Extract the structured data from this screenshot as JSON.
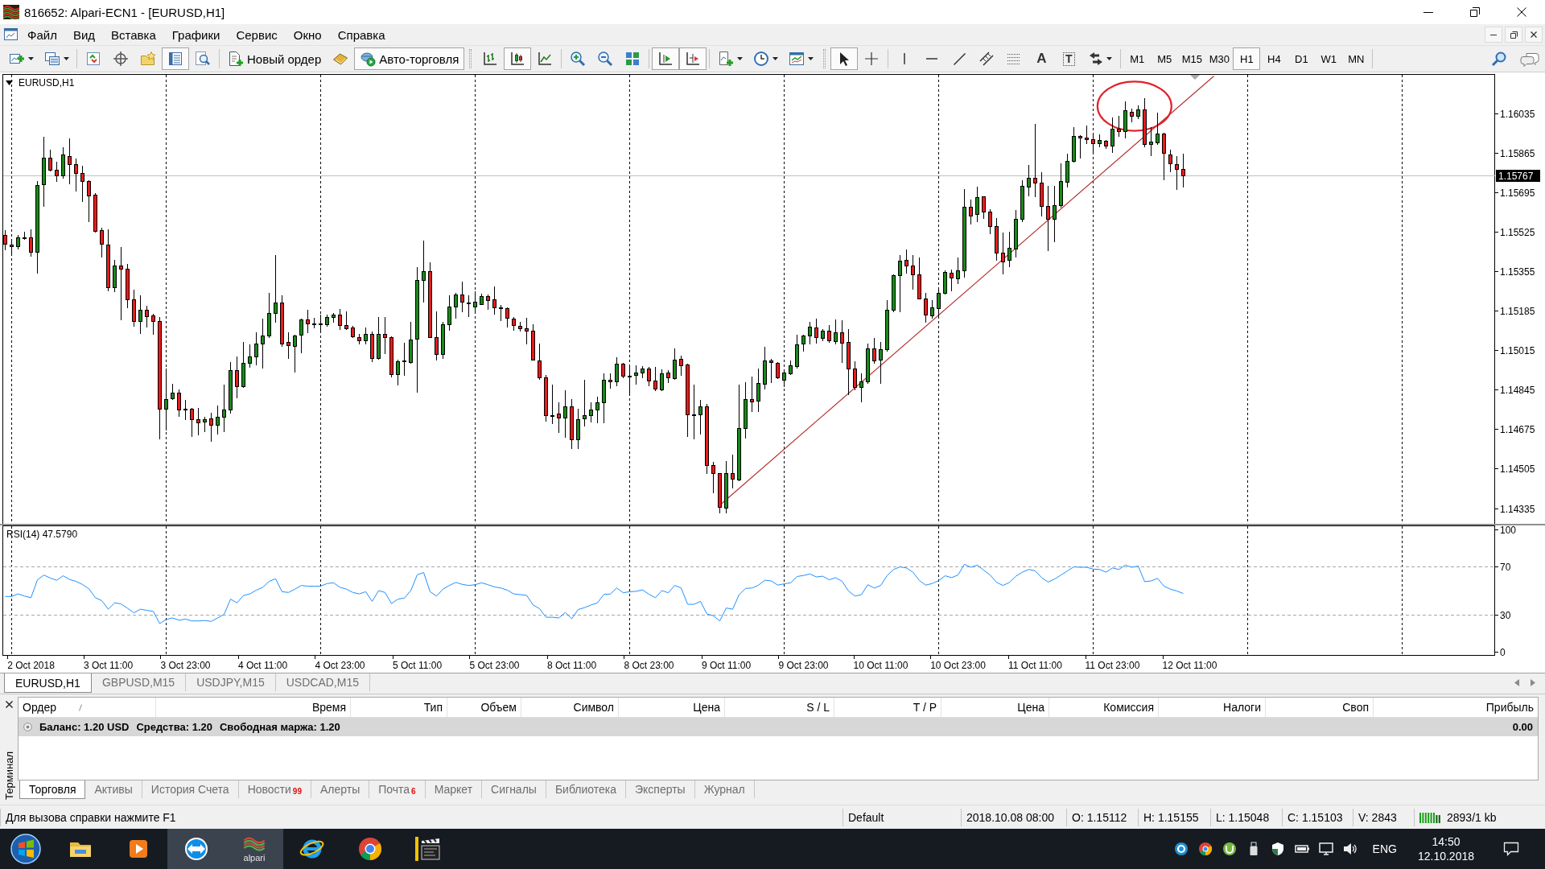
{
  "window": {
    "title": "816652: Alpari-ECN1 - [EURUSD,H1]"
  },
  "menu": [
    "Файл",
    "Вид",
    "Вставка",
    "Графики",
    "Сервис",
    "Окно",
    "Справка"
  ],
  "toolbar": {
    "items": [
      {
        "kind": "icon",
        "pressed": false
      },
      {
        "kind": "icon",
        "pressed": false
      },
      {
        "kind": "icon",
        "pressed": false
      },
      {
        "kind": "icon",
        "pressed": false
      },
      {
        "kind": "icon",
        "pressed": false
      },
      {
        "kind": "icon",
        "pressed": true
      },
      {
        "kind": "icon",
        "pressed": false
      },
      {
        "kind": "button",
        "label": "Новый ордер",
        "pressed": false
      },
      {
        "kind": "icon",
        "pressed": false
      },
      {
        "kind": "button",
        "label": "Авто-торговля",
        "pressed": true
      },
      {
        "kind": "icon",
        "pressed": false
      },
      {
        "kind": "icon",
        "pressed": true
      },
      {
        "kind": "icon",
        "pressed": false
      },
      {
        "kind": "icon",
        "pressed": false
      },
      {
        "kind": "icon",
        "pressed": false
      },
      {
        "kind": "icon",
        "pressed": false
      },
      {
        "kind": "icon",
        "pressed": true
      },
      {
        "kind": "icon",
        "pressed": true
      },
      {
        "kind": "icon",
        "pressed": false
      },
      {
        "kind": "icon",
        "pressed": false
      },
      {
        "kind": "icon",
        "pressed": false
      },
      {
        "kind": "icon",
        "pressed": true
      },
      {
        "kind": "icon",
        "pressed": false
      },
      {
        "kind": "icon",
        "pressed": false
      },
      {
        "kind": "icon",
        "pressed": false
      },
      {
        "kind": "icon",
        "pressed": false
      },
      {
        "kind": "icon",
        "pressed": false
      },
      {
        "kind": "icon",
        "pressed": false
      },
      {
        "kind": "glyph",
        "glyph": "A",
        "pressed": false
      },
      {
        "kind": "boxed_glyph",
        "glyph": "T",
        "pressed": false
      },
      {
        "kind": "icon",
        "pressed": false
      }
    ],
    "timeframes": [
      {
        "label": "M1",
        "selected": false
      },
      {
        "label": "M5",
        "selected": false
      },
      {
        "label": "M15",
        "selected": false
      },
      {
        "label": "M30",
        "selected": false
      },
      {
        "label": "H1",
        "selected": true
      },
      {
        "label": "H4",
        "selected": false
      },
      {
        "label": "D1",
        "selected": false
      },
      {
        "label": "W1",
        "selected": false
      },
      {
        "label": "MN",
        "selected": false
      }
    ]
  },
  "chart": {
    "chart_data": [
      {
        "type": "candlestick",
        "title": "EURUSD,H1",
        "ylim": [
          1.14271,
          1.16201
        ],
        "yticks": [
          1.14335,
          1.14505,
          1.14675,
          1.14845,
          1.15015,
          1.15185,
          1.15355,
          1.15525,
          1.15695,
          1.15865,
          1.16035
        ],
        "grid": true,
        "ref_lines": [
          {
            "axis": "y",
            "value": 1.15767,
            "label": "1.15767",
            "color": "#c0c0c0"
          }
        ],
        "ohlc": [
          [
            1.1551,
            1.15532,
            1.15448,
            1.15473
          ],
          [
            1.15471,
            1.15492,
            1.15426,
            1.15463
          ],
          [
            1.15462,
            1.1551,
            1.15452,
            1.15502
          ],
          [
            1.15497,
            1.15525,
            1.15494,
            1.15502
          ],
          [
            1.155,
            1.15535,
            1.15421,
            1.1544
          ],
          [
            1.15438,
            1.15742,
            1.15349,
            1.15727
          ],
          [
            1.15731,
            1.15933,
            1.15637,
            1.15845
          ],
          [
            1.15845,
            1.15879,
            1.15787,
            1.15792
          ],
          [
            1.15793,
            1.15827,
            1.15744,
            1.15768
          ],
          [
            1.15768,
            1.15889,
            1.15756,
            1.15859
          ],
          [
            1.15851,
            1.15926,
            1.15734,
            1.15817
          ],
          [
            1.15817,
            1.15841,
            1.15703,
            1.15777
          ],
          [
            1.1578,
            1.15808,
            1.15657,
            1.15744
          ],
          [
            1.15745,
            1.15746,
            1.15572,
            1.15681
          ],
          [
            1.15683,
            1.1569,
            1.15525,
            1.15528
          ],
          [
            1.15533,
            1.15541,
            1.15417,
            1.15473
          ],
          [
            1.15471,
            1.15535,
            1.15272,
            1.15286
          ],
          [
            1.15286,
            1.15403,
            1.15269,
            1.15381
          ],
          [
            1.1538,
            1.15461,
            1.15147,
            1.15365
          ],
          [
            1.15367,
            1.15386,
            1.15198,
            1.15234
          ],
          [
            1.15234,
            1.15275,
            1.15119,
            1.15141
          ],
          [
            1.15141,
            1.1525,
            1.15088,
            1.15188
          ],
          [
            1.15188,
            1.15207,
            1.15116,
            1.15162
          ],
          [
            1.15166,
            1.15172,
            1.15085,
            1.15141
          ],
          [
            1.15141,
            1.15157,
            1.14636,
            1.14763
          ],
          [
            1.14763,
            1.14936,
            1.14673,
            1.14804
          ],
          [
            1.14807,
            1.14872,
            1.14804,
            1.14832
          ],
          [
            1.14832,
            1.14845,
            1.14732,
            1.1476
          ],
          [
            1.14762,
            1.148,
            1.14717,
            1.14763
          ],
          [
            1.14763,
            1.14766,
            1.14645,
            1.14717
          ],
          [
            1.14717,
            1.14766,
            1.14652,
            1.14703
          ],
          [
            1.14707,
            1.14729,
            1.14667,
            1.14717
          ],
          [
            1.14721,
            1.14744,
            1.14626,
            1.14693
          ],
          [
            1.14693,
            1.14776,
            1.14655,
            1.1473
          ],
          [
            1.1473,
            1.14868,
            1.14665,
            1.1476
          ],
          [
            1.14758,
            1.14965,
            1.14745,
            1.14929
          ],
          [
            1.14929,
            1.14988,
            1.1481,
            1.14859
          ],
          [
            1.14859,
            1.15052,
            1.14858,
            1.14959
          ],
          [
            1.14959,
            1.15039,
            1.14944,
            1.14987
          ],
          [
            1.14987,
            1.15093,
            1.14952,
            1.15042
          ],
          [
            1.15042,
            1.15151,
            1.1494,
            1.15079
          ],
          [
            1.15079,
            1.15262,
            1.1507,
            1.15176
          ],
          [
            1.15176,
            1.15424,
            1.15138,
            1.1522
          ],
          [
            1.1522,
            1.1525,
            1.15035,
            1.15045
          ],
          [
            1.1505,
            1.15091,
            1.14983,
            1.15037
          ],
          [
            1.15033,
            1.15083,
            1.14921,
            1.15079
          ],
          [
            1.15081,
            1.15151,
            1.15006,
            1.15146
          ],
          [
            1.15146,
            1.15188,
            1.15091,
            1.1513
          ],
          [
            1.15132,
            1.15155,
            1.15114,
            1.15131
          ],
          [
            1.1513,
            1.15169,
            1.15099,
            1.15129
          ],
          [
            1.15128,
            1.15167,
            1.1512,
            1.15157
          ],
          [
            1.15157,
            1.15174,
            1.15136,
            1.15168
          ],
          [
            1.15168,
            1.15194,
            1.15107,
            1.15122
          ],
          [
            1.15123,
            1.15182,
            1.15107,
            1.15111
          ],
          [
            1.15112,
            1.1512,
            1.1507,
            1.15074
          ],
          [
            1.15073,
            1.15085,
            1.15045,
            1.15057
          ],
          [
            1.15057,
            1.15114,
            1.15045,
            1.15086
          ],
          [
            1.15086,
            1.15095,
            1.14967,
            1.1498
          ],
          [
            1.1498,
            1.15157,
            1.14977,
            1.15086
          ],
          [
            1.15086,
            1.15157,
            1.15002,
            1.15073
          ],
          [
            1.1507,
            1.15076,
            1.14903,
            1.14913
          ],
          [
            1.14913,
            1.14974,
            1.14866,
            1.14969
          ],
          [
            1.1497,
            1.15048,
            1.14909,
            1.14971
          ],
          [
            1.14965,
            1.15137,
            1.14959,
            1.1506
          ],
          [
            1.15064,
            1.15374,
            1.14835,
            1.15318
          ],
          [
            1.15318,
            1.15488,
            1.15223,
            1.15355
          ],
          [
            1.15355,
            1.15393,
            1.15072,
            1.15073
          ],
          [
            1.15073,
            1.15184,
            1.14974,
            1.14998
          ],
          [
            1.14998,
            1.15138,
            1.14983,
            1.15128
          ],
          [
            1.15128,
            1.1525,
            1.15104,
            1.15203
          ],
          [
            1.15203,
            1.15262,
            1.15153,
            1.15256
          ],
          [
            1.15256,
            1.15312,
            1.15182,
            1.15225
          ],
          [
            1.15219,
            1.1525,
            1.15163,
            1.15218
          ],
          [
            1.15204,
            1.15269,
            1.15176,
            1.15223
          ],
          [
            1.15215,
            1.15259,
            1.15213,
            1.15249
          ],
          [
            1.15249,
            1.15256,
            1.15192,
            1.15231
          ],
          [
            1.15234,
            1.15291,
            1.15172,
            1.152
          ],
          [
            1.15198,
            1.15209,
            1.15145,
            1.15197
          ],
          [
            1.15197,
            1.152,
            1.15116,
            1.15153
          ],
          [
            1.15151,
            1.15157,
            1.15101,
            1.15122
          ],
          [
            1.1512,
            1.15138,
            1.15099,
            1.1511
          ],
          [
            1.15111,
            1.15153,
            1.15045,
            1.151
          ],
          [
            1.15099,
            1.15126,
            1.14974,
            1.14975
          ],
          [
            1.14971,
            1.15045,
            1.1489,
            1.14897
          ],
          [
            1.14897,
            1.14909,
            1.14711,
            1.14735
          ],
          [
            1.14736,
            1.14866,
            1.14702,
            1.14735
          ],
          [
            1.14742,
            1.14791,
            1.14661,
            1.14726
          ],
          [
            1.14726,
            1.14841,
            1.14642,
            1.14773
          ],
          [
            1.14773,
            1.14806,
            1.14593,
            1.1463
          ],
          [
            1.1463,
            1.14763,
            1.14593,
            1.14717
          ],
          [
            1.14723,
            1.14888,
            1.1469,
            1.14735
          ],
          [
            1.14735,
            1.14791,
            1.14707,
            1.1476
          ],
          [
            1.1476,
            1.14816,
            1.14703,
            1.14791
          ],
          [
            1.14791,
            1.14915,
            1.14703,
            1.14888
          ],
          [
            1.14888,
            1.14915,
            1.14852,
            1.14881
          ],
          [
            1.14881,
            1.14986,
            1.14863,
            1.14956
          ],
          [
            1.14956,
            1.14959,
            1.14897,
            1.14905
          ],
          [
            1.14906,
            1.14952,
            1.14822,
            1.14905
          ],
          [
            1.14909,
            1.14951,
            1.14872,
            1.14918
          ],
          [
            1.14918,
            1.14946,
            1.14897,
            1.14938
          ],
          [
            1.14936,
            1.14944,
            1.14863,
            1.14884
          ],
          [
            1.14884,
            1.14944,
            1.14841,
            1.1485
          ],
          [
            1.14847,
            1.14934,
            1.14841,
            1.14915
          ],
          [
            1.14919,
            1.14928,
            1.14878,
            1.14897
          ],
          [
            1.14894,
            1.15023,
            1.1489,
            1.14975
          ],
          [
            1.14977,
            1.1499,
            1.14909,
            1.14949
          ],
          [
            1.14954,
            1.14956,
            1.14646,
            1.1474
          ],
          [
            1.14738,
            1.14868,
            1.14634,
            1.14737
          ],
          [
            1.14738,
            1.14801,
            1.14657,
            1.14775
          ],
          [
            1.14773,
            1.14785,
            1.14485,
            1.14522
          ],
          [
            1.14522,
            1.14535,
            1.14401,
            1.14485
          ],
          [
            1.14485,
            1.14486,
            1.14316,
            1.14341
          ],
          [
            1.14336,
            1.14537,
            1.14316,
            1.14487
          ],
          [
            1.14487,
            1.14566,
            1.14422,
            1.1446
          ],
          [
            1.14459,
            1.14868,
            1.14456,
            1.1468
          ],
          [
            1.1468,
            1.14878,
            1.14639,
            1.14804
          ],
          [
            1.14804,
            1.14903,
            1.14754,
            1.14795
          ],
          [
            1.14797,
            1.14938,
            1.14754,
            1.14874
          ],
          [
            1.14872,
            1.15029,
            1.1485,
            1.14971
          ],
          [
            1.14971,
            1.14977,
            1.14877,
            1.14965
          ],
          [
            1.14962,
            1.14965,
            1.14896,
            1.14897
          ],
          [
            1.14887,
            1.14928,
            1.14859,
            1.14918
          ],
          [
            1.14915,
            1.14971,
            1.14912,
            1.14949
          ],
          [
            1.14946,
            1.15083,
            1.1494,
            1.1504
          ],
          [
            1.15043,
            1.15083,
            1.15011,
            1.15078
          ],
          [
            1.15078,
            1.15137,
            1.15045,
            1.15116
          ],
          [
            1.15114,
            1.15151,
            1.15048,
            1.1507
          ],
          [
            1.15068,
            1.15107,
            1.15058,
            1.15099
          ],
          [
            1.15099,
            1.15122,
            1.15049,
            1.15058
          ],
          [
            1.15055,
            1.15147,
            1.15045,
            1.15091
          ],
          [
            1.15091,
            1.15145,
            1.14965,
            1.15048
          ],
          [
            1.15049,
            1.15107,
            1.14825,
            1.14936
          ],
          [
            1.14936,
            1.14967,
            1.14847,
            1.14857
          ],
          [
            1.14857,
            1.14915,
            1.14794,
            1.14881
          ],
          [
            1.14881,
            1.15045,
            1.14874,
            1.15023
          ],
          [
            1.15023,
            1.15068,
            1.14961,
            1.14971
          ],
          [
            1.14975,
            1.15049,
            1.14875,
            1.15018
          ],
          [
            1.15018,
            1.15231,
            1.15011,
            1.15188
          ],
          [
            1.15188,
            1.15343,
            1.15184,
            1.15337
          ],
          [
            1.15337,
            1.15426,
            1.15182,
            1.154
          ],
          [
            1.15405,
            1.15448,
            1.15349,
            1.1538
          ],
          [
            1.1538,
            1.15426,
            1.15281,
            1.15343
          ],
          [
            1.15341,
            1.15415,
            1.15237,
            1.15238
          ],
          [
            1.15238,
            1.15262,
            1.15137,
            1.15169
          ],
          [
            1.15166,
            1.15231,
            1.15155,
            1.152
          ],
          [
            1.15197,
            1.15287,
            1.15159,
            1.15262
          ],
          [
            1.15262,
            1.15358,
            1.15259,
            1.15352
          ],
          [
            1.15349,
            1.15362,
            1.15271,
            1.15328
          ],
          [
            1.15324,
            1.15415,
            1.15303,
            1.15359
          ],
          [
            1.15359,
            1.15709,
            1.15331,
            1.15634
          ],
          [
            1.15634,
            1.15665,
            1.1556,
            1.15595
          ],
          [
            1.156,
            1.15718,
            1.15572,
            1.15675
          ],
          [
            1.15678,
            1.15679,
            1.15585,
            1.15613
          ],
          [
            1.15613,
            1.15622,
            1.15517,
            1.15548
          ],
          [
            1.15548,
            1.15585,
            1.15403,
            1.15436
          ],
          [
            1.15436,
            1.15523,
            1.15346,
            1.15396
          ],
          [
            1.15403,
            1.15525,
            1.15378,
            1.15455
          ],
          [
            1.15452,
            1.15618,
            1.15417,
            1.15581
          ],
          [
            1.15581,
            1.15746,
            1.15569,
            1.15724
          ],
          [
            1.15721,
            1.15814,
            1.1568,
            1.15758
          ],
          [
            1.15758,
            1.15988,
            1.15678,
            1.15737
          ],
          [
            1.15737,
            1.15783,
            1.15595,
            1.15637
          ],
          [
            1.15637,
            1.15724,
            1.15445,
            1.15581
          ],
          [
            1.15581,
            1.15724,
            1.15483,
            1.15641
          ],
          [
            1.15638,
            1.1582,
            1.15634,
            1.15742
          ],
          [
            1.1574,
            1.1586,
            1.15721,
            1.1583
          ],
          [
            1.1583,
            1.15975,
            1.15827,
            1.15938
          ],
          [
            1.15938,
            1.15941,
            1.15845,
            1.1593
          ],
          [
            1.15932,
            1.15982,
            1.15907,
            1.15923
          ],
          [
            1.15924,
            1.15941,
            1.1586,
            1.15907
          ],
          [
            1.15907,
            1.15944,
            1.15892,
            1.1592
          ],
          [
            1.15917,
            1.1592,
            1.15885,
            1.15895
          ],
          [
            1.15895,
            1.16019,
            1.1587,
            1.15969
          ],
          [
            1.15969,
            1.16025,
            1.15936,
            1.15957
          ],
          [
            1.15959,
            1.16087,
            1.15932,
            1.16047
          ],
          [
            1.16042,
            1.16054,
            1.16,
            1.16025
          ],
          [
            1.16023,
            1.16068,
            1.16013,
            1.16052
          ],
          [
            1.16052,
            1.16099,
            1.15891,
            1.15904
          ],
          [
            1.15904,
            1.15975,
            1.15855,
            1.15912
          ],
          [
            1.1591,
            1.16037,
            1.15904,
            1.15947
          ],
          [
            1.15947,
            1.15951,
            1.1575,
            1.15864
          ],
          [
            1.15858,
            1.1588,
            1.15786,
            1.1582
          ],
          [
            1.15817,
            1.15851,
            1.15709,
            1.15796
          ],
          [
            1.15796,
            1.1586,
            1.15719,
            1.15767
          ],
          null,
          null,
          null,
          null,
          null,
          null,
          null,
          null,
          null,
          null,
          null,
          null,
          null,
          null,
          null,
          null,
          null,
          null,
          null,
          null,
          null,
          null,
          null,
          null,
          null,
          null,
          null,
          null,
          null,
          null,
          null,
          null,
          null,
          null,
          null,
          null,
          null,
          null,
          null,
          null,
          null,
          null,
          null,
          null,
          null,
          null,
          null,
          null
        ]
      },
      {
        "type": "line",
        "title": "RSI(14) 47.5790",
        "color": "#1e90ff",
        "ylim": [
          -3,
          103
        ],
        "yticks": [
          0,
          30,
          70,
          100
        ],
        "grid": true,
        "ref_lines": [
          {
            "axis": "y",
            "value": 70,
            "color": "#a8a8a8",
            "line_style": "dashed"
          },
          {
            "axis": "y",
            "value": 30,
            "color": "#a8a8a8",
            "line_style": "dashed"
          }
        ],
        "categories": [
          null,
          null,
          null,
          null,
          "2 Oct 2018",
          null,
          null,
          null,
          null,
          null,
          null,
          null,
          null,
          null,
          null,
          null,
          "3 Oct 11:00",
          null,
          null,
          null,
          null,
          null,
          null,
          null,
          null,
          null,
          null,
          null,
          "3 Oct 23:00",
          null,
          null,
          null,
          null,
          null,
          null,
          null,
          null,
          null,
          null,
          null,
          "4 Oct 11:00",
          null,
          null,
          null,
          null,
          null,
          null,
          null,
          null,
          null,
          null,
          null,
          "4 Oct 23:00",
          null,
          null,
          null,
          null,
          null,
          null,
          null,
          null,
          null,
          null,
          null,
          "5 Oct 11:00",
          null,
          null,
          null,
          null,
          null,
          null,
          null,
          null,
          null,
          null,
          null,
          "5 Oct 23:00",
          null,
          null,
          null,
          null,
          null,
          null,
          null,
          null,
          null,
          null,
          null,
          "8 Oct 11:00",
          null,
          null,
          null,
          null,
          null,
          null,
          null,
          null,
          null,
          null,
          null,
          "8 Oct 23:00",
          null,
          null,
          null,
          null,
          null,
          null,
          null,
          null,
          null,
          null,
          null,
          "9 Oct 11:00",
          null,
          null,
          null,
          null,
          null,
          null,
          null,
          null,
          null,
          null,
          null,
          "9 Oct 23:00",
          null,
          null,
          null,
          null,
          null,
          null,
          null,
          null,
          null,
          null,
          null,
          "10 Oct 11:00",
          null,
          null,
          null,
          null,
          null,
          null,
          null,
          null,
          null,
          null,
          null,
          "10 Oct 23:00",
          null,
          null,
          null,
          null,
          null,
          null,
          null,
          null,
          null,
          null,
          null,
          "11 Oct 11:00",
          null,
          null,
          null,
          null,
          null,
          null,
          null,
          null,
          null,
          null,
          null,
          "11 Oct 23:00",
          null,
          null,
          null,
          null,
          null,
          null,
          null,
          null,
          null,
          null,
          null,
          "12 Oct 11:00",
          null,
          null,
          null,
          null,
          null,
          null,
          null,
          null,
          null,
          null,
          null,
          null,
          null,
          null,
          null,
          null,
          null,
          null,
          null,
          null,
          null,
          null,
          null,
          null,
          null,
          null,
          null,
          null,
          null,
          null,
          null,
          null,
          null,
          null,
          null,
          null,
          null,
          null,
          null,
          null,
          null,
          null,
          null,
          null,
          null,
          null,
          null
        ],
        "values": [
          45.2,
          45.2,
          47.3,
          45.5,
          44.2,
          58.8,
          62.7,
          60.3,
          58.5,
          62.1,
          59.1,
          57.5,
          55,
          51.5,
          44.2,
          41.8,
          34.8,
          40,
          39.1,
          35.5,
          31.8,
          34.8,
          33.9,
          33,
          23,
          26.4,
          27.6,
          25.8,
          26.7,
          25.2,
          25.2,
          25.5,
          24.8,
          27.6,
          30.6,
          43,
          40,
          46,
          47.3,
          50.3,
          52.7,
          57.6,
          59.7,
          49.1,
          48.5,
          51.2,
          54.2,
          53.6,
          53.6,
          53.6,
          55.8,
          56.4,
          52.7,
          51.2,
          48.5,
          47.3,
          49.1,
          41.2,
          50,
          48.5,
          39.4,
          43,
          43.9,
          50,
          63,
          64.8,
          49.1,
          45.5,
          51.2,
          54.2,
          56.7,
          55.1,
          54.2,
          54.8,
          56.4,
          54.8,
          53,
          52.1,
          50.3,
          47.3,
          46.7,
          46.1,
          38.2,
          35.2,
          28.2,
          28.2,
          27.6,
          32.1,
          27,
          34.5,
          36.1,
          38.2,
          40,
          47,
          47.2,
          52.1,
          48.2,
          49.1,
          49.4,
          50.6,
          47,
          44.2,
          50,
          48.2,
          54.2,
          52.1,
          38.8,
          38.8,
          41.2,
          30.9,
          29.4,
          25.2,
          35.8,
          34.8,
          46.7,
          51.8,
          52.1,
          54.5,
          58.5,
          57.9,
          54.5,
          55.5,
          56.4,
          61.5,
          62.4,
          63.6,
          61.2,
          61.8,
          58.8,
          60.6,
          57.6,
          49.7,
          45.5,
          46.7,
          54.8,
          52.1,
          54.2,
          62.4,
          67.3,
          69.4,
          68.5,
          65.1,
          58.2,
          54.5,
          55.8,
          58.2,
          62.1,
          60.6,
          62.7,
          71.5,
          69.1,
          70.9,
          66.7,
          62.7,
          56.7,
          54.2,
          56.7,
          61.8,
          65.1,
          67.3,
          66.1,
          60.6,
          57,
          59.4,
          62.7,
          66.1,
          69.4,
          69.1,
          69.1,
          67.6,
          67.3,
          65.1,
          68.5,
          67.3,
          70.9,
          69.1,
          70,
          57.3,
          57.9,
          60,
          53.6,
          51.2,
          49.7,
          47.6,
          null,
          null,
          null,
          null,
          null,
          null,
          null,
          null,
          null,
          null,
          null,
          null,
          null,
          null,
          null,
          null,
          null,
          null,
          null,
          null,
          null,
          null,
          null,
          null,
          null,
          null,
          null,
          null,
          null,
          null,
          null,
          null,
          null,
          null,
          null,
          null,
          null,
          null,
          null,
          null,
          null,
          null,
          null,
          null,
          null,
          null,
          null,
          null
        ]
      }
    ]
  },
  "chart_tabs": [
    {
      "label": "EURUSD,H1",
      "selected": true
    },
    {
      "label": "GBPUSD,M15",
      "selected": false
    },
    {
      "label": "USDJPY,M15",
      "selected": false
    },
    {
      "label": "USDCAD,M15",
      "selected": false
    }
  ],
  "terminal": {
    "title": "Терминал",
    "columns": [
      {
        "label": "Ордер",
        "sorted": true
      },
      {
        "label": "Время",
        "sorted": false
      },
      {
        "label": "Тип",
        "sorted": false
      },
      {
        "label": "Объем",
        "sorted": false
      },
      {
        "label": "Символ",
        "sorted": false
      },
      {
        "label": "Цена",
        "sorted": false
      },
      {
        "label": "S / L",
        "sorted": false
      },
      {
        "label": "T / P",
        "sorted": false
      },
      {
        "label": "Цена",
        "sorted": false
      },
      {
        "label": "Комиссия",
        "sorted": false
      },
      {
        "label": "Налоги",
        "sorted": false
      },
      {
        "label": "Своп",
        "sorted": false
      },
      {
        "label": "Прибыль",
        "sorted": false
      }
    ],
    "balance": {
      "parts": [
        "Баланс: 1.20 USD",
        "Средства: 1.20",
        "Свободная маржа: 1.20"
      ],
      "profit": "0.00"
    },
    "tabs": [
      {
        "label": "Торговля",
        "selected": true
      },
      {
        "label": "Активы",
        "selected": false
      },
      {
        "label": "История Счета",
        "selected": false
      },
      {
        "label": "Новости",
        "badge": "99",
        "selected": false
      },
      {
        "label": "Алерты",
        "selected": false
      },
      {
        "label": "Почта",
        "badge": "6",
        "selected": false
      },
      {
        "label": "Маркет",
        "selected": false
      },
      {
        "label": "Сигналы",
        "selected": false
      },
      {
        "label": "Библиотека",
        "selected": false
      },
      {
        "label": "Эксперты",
        "selected": false
      },
      {
        "label": "Журнал",
        "selected": false
      }
    ]
  },
  "status_bar": {
    "help": "Для вызова справки нажмите F1",
    "profile": "Default",
    "bar_time": "2018.10.08 08:00",
    "open": "O: 1.15112",
    "high": "H: 1.15155",
    "low": "L: 1.15048",
    "close": "C: 1.15103",
    "volume": "V: 2843",
    "traffic": "2893/1 kb"
  },
  "taskbar": {
    "apps": [
      {
        "open": false
      },
      {
        "open": false
      },
      {
        "open": true
      },
      {
        "open": true,
        "label": "alpari"
      },
      {
        "open": false
      },
      {
        "open": false
      },
      {
        "open": false
      }
    ],
    "tray": {
      "language": "ENG",
      "time": "14:50",
      "date": "12.10.2018"
    }
  }
}
